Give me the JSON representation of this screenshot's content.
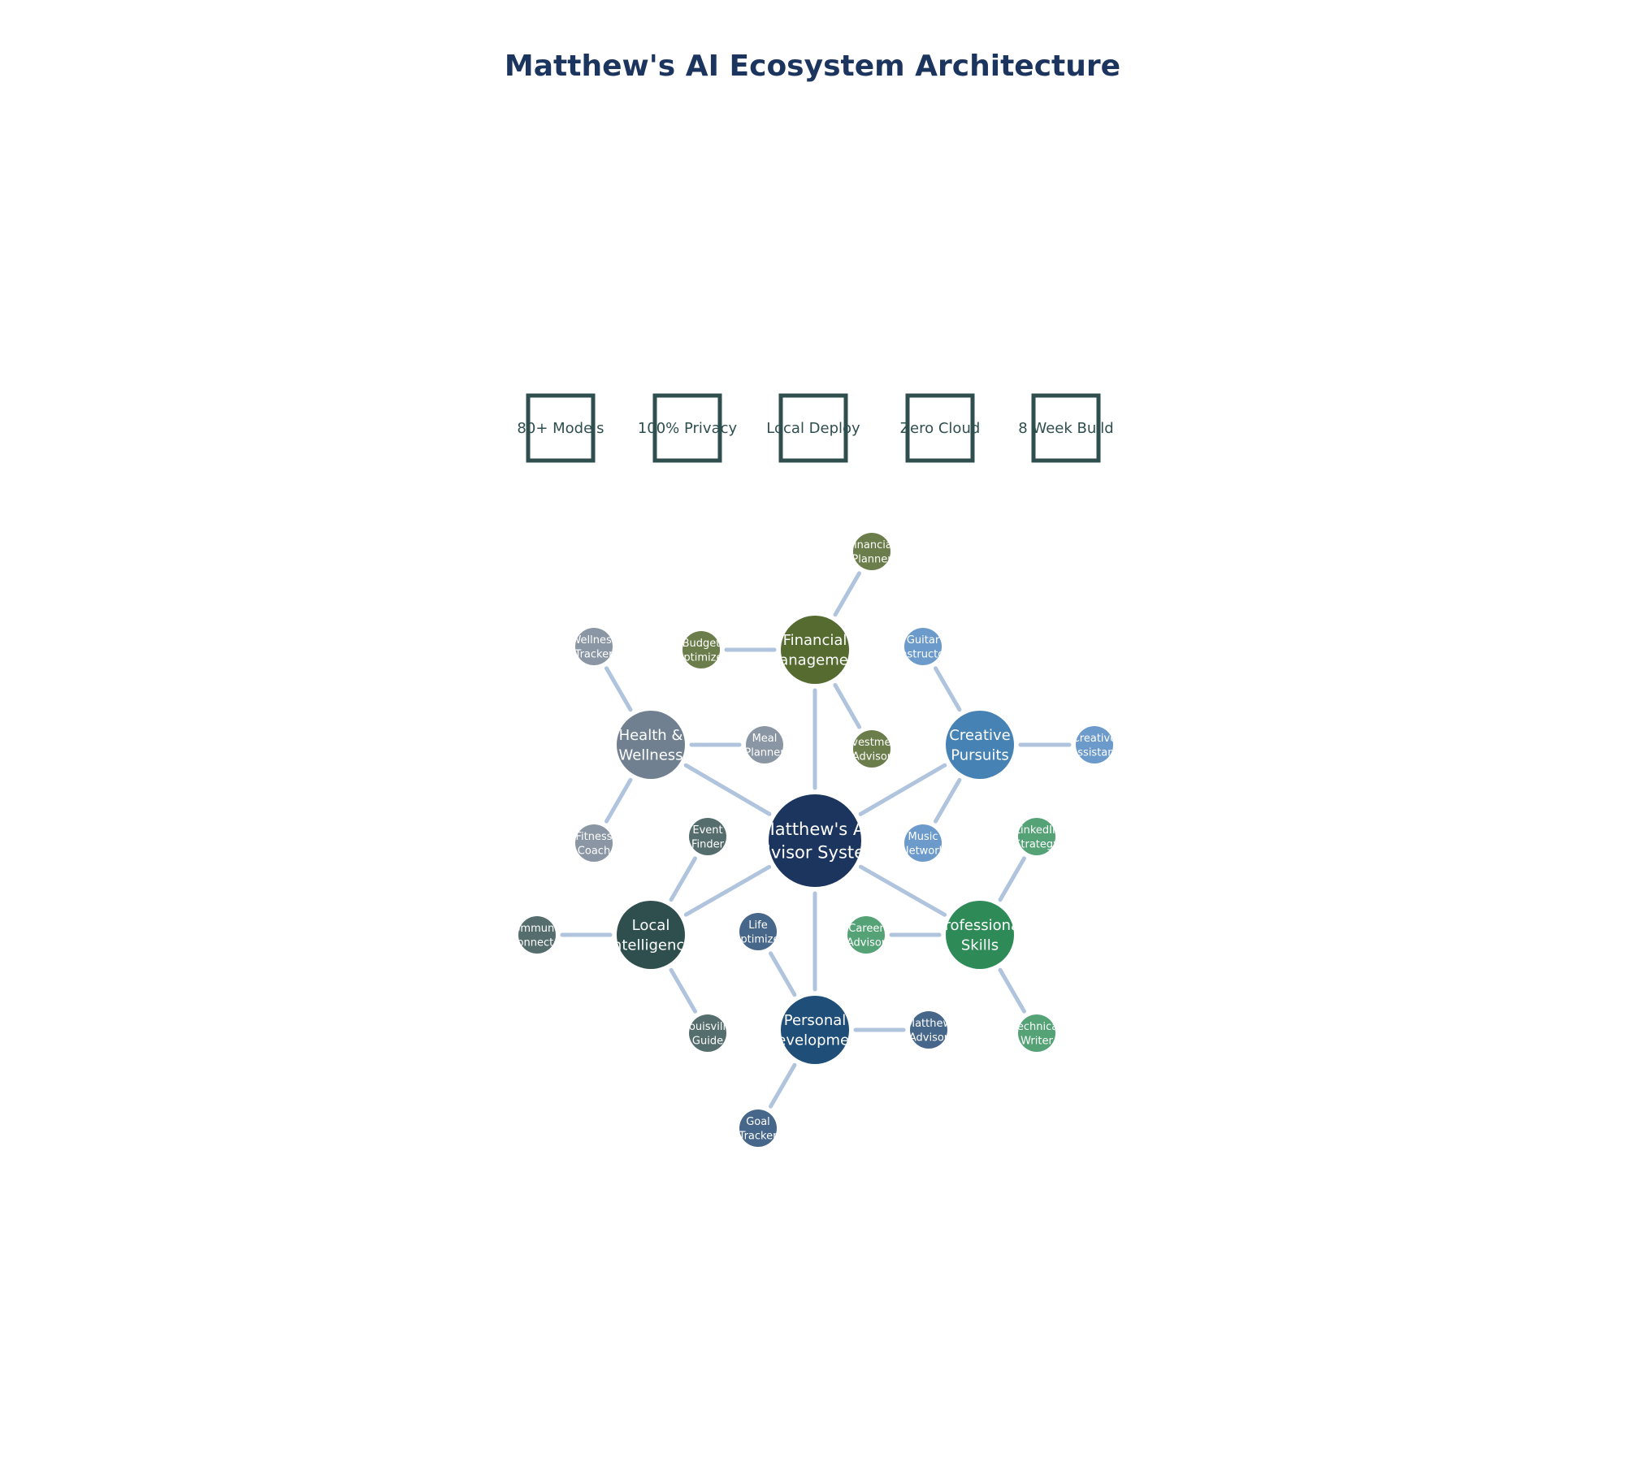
{
  "title": "Matthew's AI Ecosystem Architecture",
  "stats": [
    {
      "label": "80+ Models"
    },
    {
      "label": "100% Privacy"
    },
    {
      "label": "Local Deploy"
    },
    {
      "label": "Zero Cloud"
    },
    {
      "label": "8 Week Build"
    }
  ],
  "center": {
    "lines": [
      "Matthew's AI",
      "Advisor System"
    ],
    "color": "#1c355e"
  },
  "categories": [
    {
      "id": "financial",
      "lines": [
        "Financial",
        "Management"
      ],
      "color": "#556b2f",
      "child_color": "#6b7d4a",
      "children": [
        {
          "lines": [
            "Financial",
            "Planner"
          ]
        },
        {
          "lines": [
            "Budget",
            "Optimizer"
          ]
        },
        {
          "lines": [
            "Investment",
            "Advisor"
          ]
        }
      ]
    },
    {
      "id": "creative",
      "lines": [
        "Creative",
        "Pursuits"
      ],
      "color": "#4682b4",
      "child_color": "#6b9acb",
      "children": [
        {
          "lines": [
            "Guitar",
            "Instructor"
          ]
        },
        {
          "lines": [
            "Creative",
            "Assistant"
          ]
        },
        {
          "lines": [
            "Music",
            "Network"
          ]
        }
      ]
    },
    {
      "id": "professional",
      "lines": [
        "Professional",
        "Skills"
      ],
      "color": "#2e8b57",
      "child_color": "#54a275",
      "children": [
        {
          "lines": [
            "LinkedIn",
            "Strategy"
          ]
        },
        {
          "lines": [
            "Technical",
            "Writer"
          ]
        },
        {
          "lines": [
            "Career",
            "Advisor"
          ]
        }
      ]
    },
    {
      "id": "personal",
      "lines": [
        "Personal",
        "Development"
      ],
      "color": "#1f4e79",
      "child_color": "#46668a",
      "children": [
        {
          "lines": [
            "Matthew",
            "Advisor"
          ]
        },
        {
          "lines": [
            "Goal",
            "Tracker"
          ]
        },
        {
          "lines": [
            "Life",
            "Optimizer"
          ]
        }
      ]
    },
    {
      "id": "local",
      "lines": [
        "Local",
        "Intelligence"
      ],
      "color": "#2f4f4f",
      "child_color": "#566d6d",
      "children": [
        {
          "lines": [
            "Louisville",
            "Guide"
          ]
        },
        {
          "lines": [
            "Community",
            "Connector"
          ]
        },
        {
          "lines": [
            "Event",
            "Finder"
          ]
        }
      ]
    },
    {
      "id": "health",
      "lines": [
        "Health &",
        "Wellness"
      ],
      "color": "#708090",
      "child_color": "#8a96a3",
      "children": [
        {
          "lines": [
            "Fitness",
            "Coach"
          ]
        },
        {
          "lines": [
            "Wellness",
            "Tracker"
          ]
        },
        {
          "lines": [
            "Meal",
            "Planner"
          ]
        }
      ]
    }
  ],
  "colors": {
    "edge": "#b0c4de",
    "stat_box": "#2f4f4f",
    "title": "#1c355e"
  }
}
